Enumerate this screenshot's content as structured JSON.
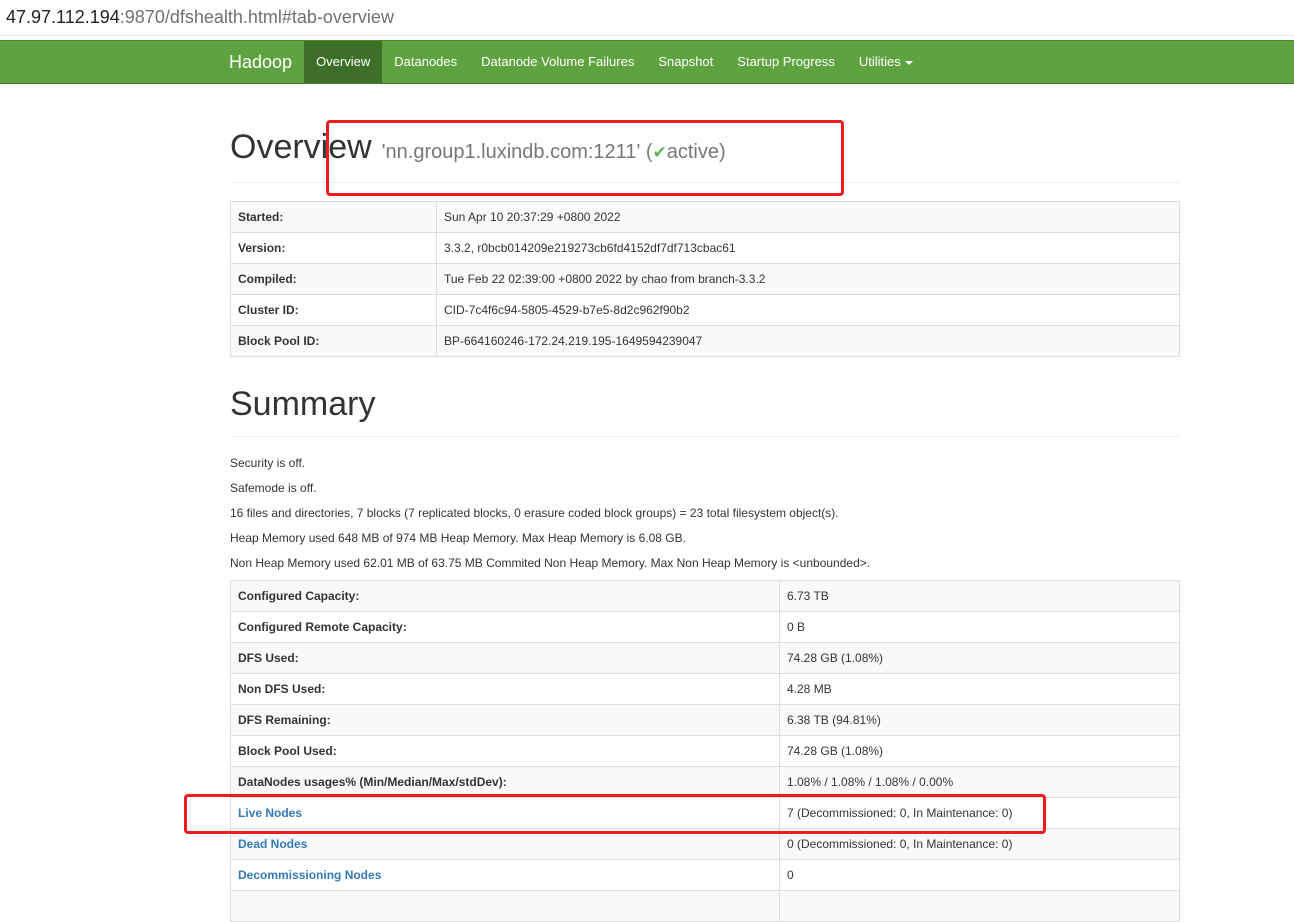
{
  "browser": {
    "url_host": "47.97.112.194",
    "url_rest": ":9870/dfshealth.html#tab-overview"
  },
  "nav": {
    "brand": "Hadoop",
    "items": [
      {
        "label": "Overview",
        "active": true
      },
      {
        "label": "Datanodes"
      },
      {
        "label": "Datanode Volume Failures"
      },
      {
        "label": "Snapshot"
      },
      {
        "label": "Startup Progress"
      },
      {
        "label": "Utilities"
      }
    ]
  },
  "overview": {
    "title": "Overview",
    "namenode": "'nn.group1.luxindb.com:1211'",
    "state": "active",
    "rows": [
      {
        "key": "Started:",
        "value": "Sun Apr 10 20:37:29 +0800 2022"
      },
      {
        "key": "Version:",
        "value": "3.3.2, r0bcb014209e219273cb6fd4152df7df713cbac61"
      },
      {
        "key": "Compiled:",
        "value": "Tue Feb 22 02:39:00 +0800 2022 by chao from branch-3.3.2"
      },
      {
        "key": "Cluster ID:",
        "value": "CID-7c4f6c94-5805-4529-b7e5-8d2c962f90b2"
      },
      {
        "key": "Block Pool ID:",
        "value": "BP-664160246-172.24.219.195-1649594239047"
      }
    ]
  },
  "summary": {
    "title": "Summary",
    "lines": [
      "Security is off.",
      "Safemode is off.",
      "16 files and directories, 7 blocks (7 replicated blocks, 0 erasure coded block groups) = 23 total filesystem object(s).",
      "Heap Memory used 648 MB of 974 MB Heap Memory. Max Heap Memory is 6.08 GB.",
      "Non Heap Memory used 62.01 MB of 63.75 MB Commited Non Heap Memory. Max Non Heap Memory is <unbounded>."
    ],
    "rows": [
      {
        "key": "Configured Capacity:",
        "value": "6.73 TB"
      },
      {
        "key": "Configured Remote Capacity:",
        "value": "0 B"
      },
      {
        "key": "DFS Used:",
        "value": "74.28 GB (1.08%)"
      },
      {
        "key": "Non DFS Used:",
        "value": "4.28 MB"
      },
      {
        "key": "DFS Remaining:",
        "value": "6.38 TB (94.81%)"
      },
      {
        "key": "Block Pool Used:",
        "value": "74.28 GB (1.08%)"
      },
      {
        "key": "DataNodes usages% (Min/Median/Max/stdDev):",
        "value": "1.08% / 1.08% / 1.08% / 0.00%"
      },
      {
        "key": "Live Nodes",
        "value": "7 (Decommissioned: 0, In Maintenance: 0)"
      },
      {
        "key": "Dead Nodes",
        "value": "0 (Decommissioned: 0, In Maintenance: 0)"
      },
      {
        "key": "Decommissioning Nodes",
        "value": "0"
      }
    ]
  },
  "colors": {
    "navbar": "#5fa341",
    "active_tab": "#3e6f29",
    "link": "#337ab7",
    "annotation": "#ee1c1c"
  }
}
